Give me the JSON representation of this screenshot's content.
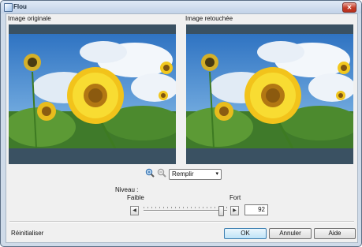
{
  "window": {
    "title": "Flou"
  },
  "panels": {
    "original_label": "Image originale",
    "retouched_label": "Image retouchée"
  },
  "zoom": {
    "mode": "Remplir",
    "in_icon": "zoom-in-icon",
    "out_icon": "zoom-out-icon"
  },
  "level": {
    "label": "Niveau :",
    "min_label": "Faible",
    "max_label": "Fort",
    "value": "92",
    "fraction": 0.92
  },
  "footer": {
    "reset_label": "Réinitialiser",
    "ok": "OK",
    "cancel": "Annuler",
    "help": "Aide"
  },
  "colors": {
    "sky": "#5d9ad3",
    "sunflower": "#f7d417",
    "accent": "#3c7fb1"
  }
}
